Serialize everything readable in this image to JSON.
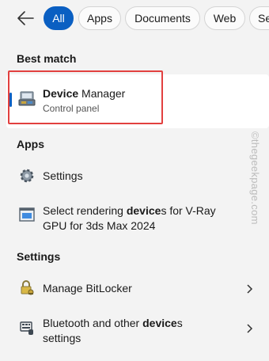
{
  "filters": {
    "back_label": "Back",
    "tabs": [
      {
        "label": "All",
        "active": true
      },
      {
        "label": "Apps",
        "active": false
      },
      {
        "label": "Documents",
        "active": false
      },
      {
        "label": "Web",
        "active": false
      },
      {
        "label": "Se",
        "active": false
      }
    ]
  },
  "best_match": {
    "heading": "Best match",
    "item": {
      "title_bold": "Device",
      "title_rest": " Manager",
      "subtitle": "Control panel",
      "icon": "device-manager-icon"
    }
  },
  "apps": {
    "heading": "Apps",
    "items": [
      {
        "title": "Settings",
        "icon": "gear-icon"
      },
      {
        "line1_pre": "Select rendering ",
        "line1_bold": "device",
        "line1_post": "s for V-Ray",
        "line2": "GPU for 3ds Max 2024",
        "icon": "app-window-icon"
      }
    ]
  },
  "settings": {
    "heading": "Settings",
    "items": [
      {
        "title": "Manage BitLocker",
        "icon": "lock-key-icon",
        "has_chevron": true
      },
      {
        "line1_pre": "Bluetooth and other ",
        "line1_bold": "device",
        "line1_post": "s",
        "line2": "settings",
        "icon": "bluetooth-devices-icon",
        "has_chevron": true
      }
    ]
  },
  "watermark": "©thegeekpage.com",
  "colors": {
    "accent": "#0a5fc2",
    "highlight": "#e2403f",
    "background": "#f3f3f3"
  }
}
